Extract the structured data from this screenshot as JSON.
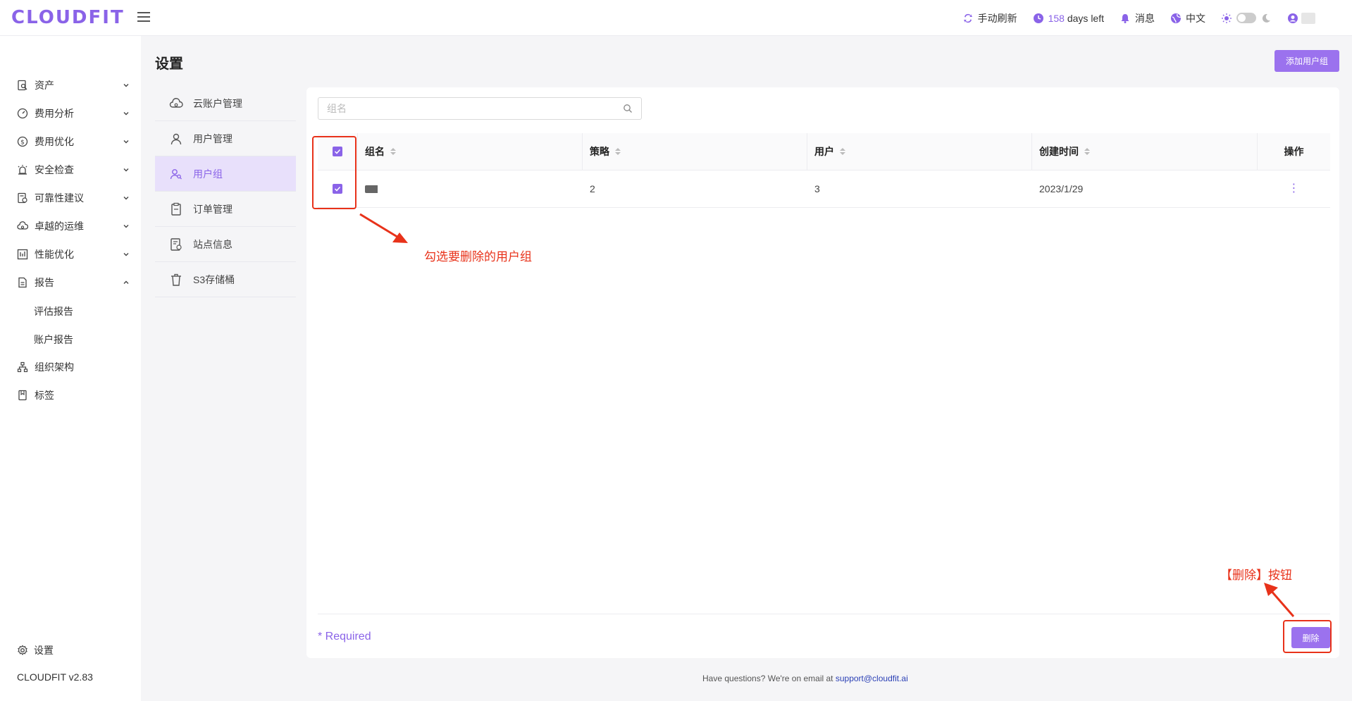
{
  "app": {
    "logo": "CLOUDFIT"
  },
  "topbar": {
    "refresh": "手动刷新",
    "days_num": "158",
    "days_label": " days left",
    "messages": "消息",
    "language": "中文"
  },
  "sidebar": {
    "items": [
      {
        "label": "资产",
        "icon": "asset-icon"
      },
      {
        "label": "费用分析",
        "icon": "gauge-icon"
      },
      {
        "label": "费用优化",
        "icon": "dollar-icon"
      },
      {
        "label": "安全检查",
        "icon": "alarm-icon"
      },
      {
        "label": "可靠性建议",
        "icon": "checklist-icon"
      },
      {
        "label": "卓越的运维",
        "icon": "cloud-sync-icon"
      },
      {
        "label": "性能优化",
        "icon": "chart-icon"
      },
      {
        "label": "报告",
        "icon": "report-icon"
      },
      {
        "label": "组织架构",
        "icon": "org-icon"
      },
      {
        "label": "标签",
        "icon": "bookmark-icon"
      }
    ],
    "report_sub": [
      "评估报告",
      "账户报告"
    ],
    "settings": "设置",
    "version": "CLOUDFIT v2.83"
  },
  "main": {
    "title": "设置",
    "add_button": "添加用户组",
    "settings_menu": [
      {
        "label": "云账户管理",
        "icon": "cloud-icon"
      },
      {
        "label": "用户管理",
        "icon": "user-icon"
      },
      {
        "label": "用户组",
        "icon": "user-group-icon"
      },
      {
        "label": "订单管理",
        "icon": "clipboard-icon"
      },
      {
        "label": "站点信息",
        "icon": "site-icon"
      },
      {
        "label": "S3存储桶",
        "icon": "bucket-icon"
      }
    ],
    "search_placeholder": "组名",
    "table": {
      "headers": [
        "组名",
        "策略",
        "用户",
        "创建时间",
        "操作"
      ],
      "rows": [
        {
          "policy": "2",
          "users": "3",
          "created": "2023/1/29",
          "action": "⋮"
        }
      ]
    },
    "required": "* Required",
    "delete_button": "删除"
  },
  "annotations": {
    "check_hint": "勾选要删除的用户组",
    "delete_hint": "【删除】按钮",
    "color": "#e8321a"
  },
  "footer": {
    "text": "Have questions? We're on email at ",
    "email": "support@cloudfit.ai"
  },
  "colors": {
    "accent": "#8a63e8",
    "button": "#9b72ee",
    "active_bg": "#e8e0fb"
  }
}
